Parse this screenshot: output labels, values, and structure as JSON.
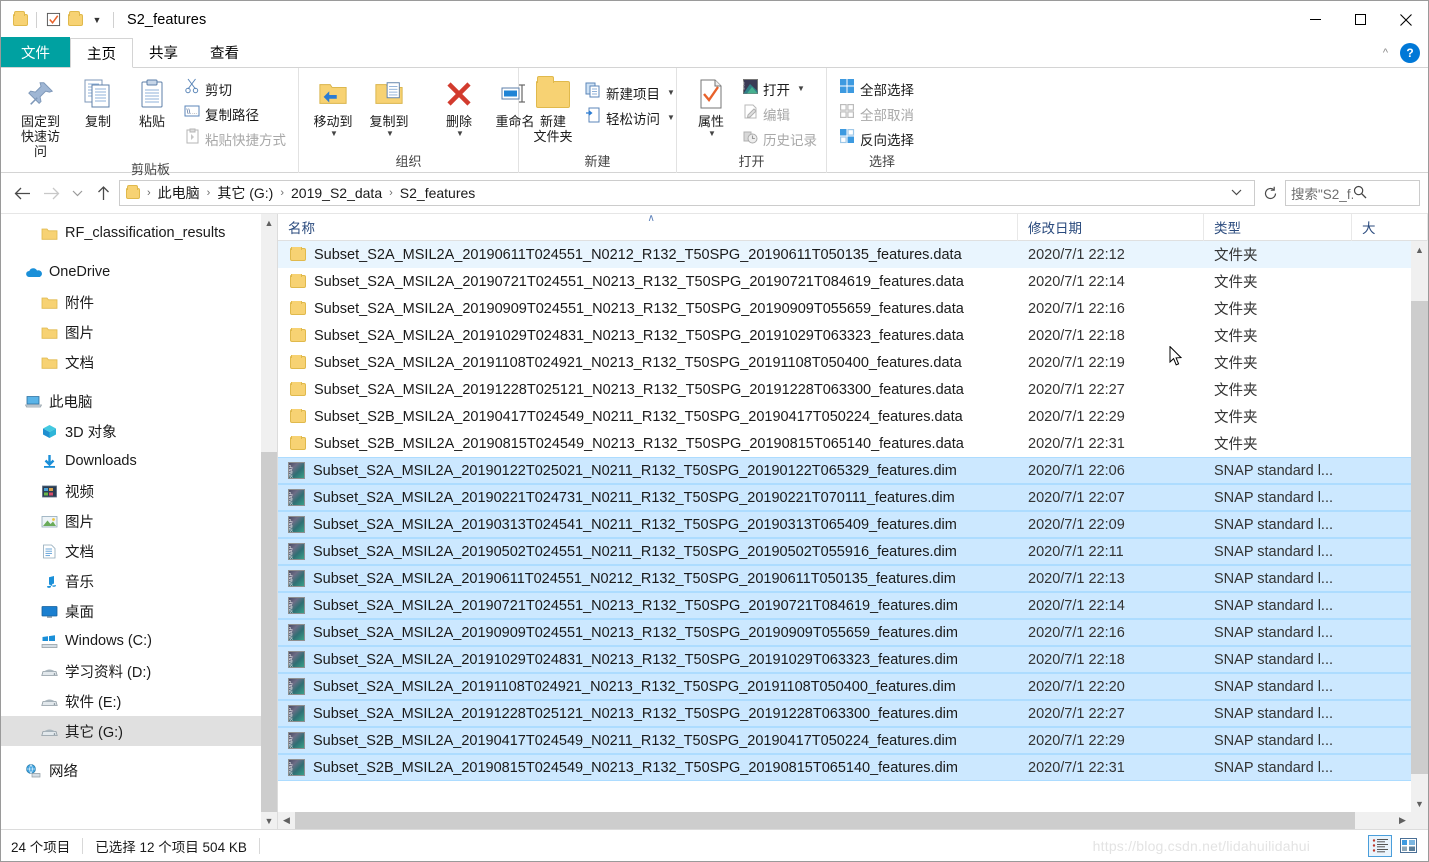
{
  "window": {
    "title": "S2_features",
    "minimize_label": "─",
    "maximize_label": "☐",
    "close_label": "✕",
    "qat_folder_icon": "folder-icon",
    "qat_properties_icon": "checkbox-properties-icon",
    "qat_newfolder_icon": "new-folder-icon",
    "qat_dropdown_icon": "chevron-down-icon"
  },
  "ribbon": {
    "tabs": [
      {
        "label": "文件",
        "id": "file"
      },
      {
        "label": "主页",
        "id": "home"
      },
      {
        "label": "共享",
        "id": "share"
      },
      {
        "label": "查看",
        "id": "view"
      }
    ],
    "collapse_icon": "chevron-up-icon",
    "help_label": "?",
    "groups": [
      {
        "name": "剪贴板",
        "big": [
          {
            "label1": "固定到",
            "label2": "快速访问",
            "icon": "pin-icon"
          },
          {
            "label1": "复制",
            "label2": "",
            "icon": "copy-icon"
          },
          {
            "label1": "粘贴",
            "label2": "",
            "icon": "paste-icon"
          }
        ],
        "small": [
          {
            "label": "剪切",
            "icon": "scissors-icon",
            "disabled": false
          },
          {
            "label": "复制路径",
            "icon": "copy-path-icon",
            "disabled": false
          },
          {
            "label": "粘贴快捷方式",
            "icon": "paste-shortcut-icon",
            "disabled": true
          }
        ]
      },
      {
        "name": "组织",
        "big": [
          {
            "label1": "移动到",
            "label2": "",
            "icon": "move-to-icon",
            "caret": true
          },
          {
            "label1": "复制到",
            "label2": "",
            "icon": "copy-to-icon",
            "caret": true
          },
          {
            "label1": "删除",
            "label2": "",
            "icon": "delete-icon",
            "caret": true
          },
          {
            "label1": "重命名",
            "label2": "",
            "icon": "rename-icon"
          }
        ],
        "small": []
      },
      {
        "name": "新建",
        "big": [
          {
            "label1": "新建",
            "label2": "文件夹",
            "icon": "new-folder-icon"
          }
        ],
        "small": [
          {
            "label": "新建项目",
            "icon": "new-item-icon",
            "disabled": false,
            "caret": true
          },
          {
            "label": "轻松访问",
            "icon": "easy-access-icon",
            "disabled": false,
            "caret": true
          }
        ]
      },
      {
        "name": "打开",
        "big": [
          {
            "label1": "属性",
            "label2": "",
            "icon": "properties-icon",
            "caret": true
          }
        ],
        "small": [
          {
            "label": "打开",
            "icon": "open-snap-icon",
            "disabled": false,
            "caret": true
          },
          {
            "label": "编辑",
            "icon": "edit-icon",
            "disabled": true
          },
          {
            "label": "历史记录",
            "icon": "history-icon",
            "disabled": true
          }
        ]
      },
      {
        "name": "选择",
        "big": [],
        "small": [
          {
            "label": "全部选择",
            "icon": "select-all-icon",
            "disabled": false
          },
          {
            "label": "全部取消",
            "icon": "select-none-icon",
            "disabled": true
          },
          {
            "label": "反向选择",
            "icon": "invert-selection-icon",
            "disabled": false
          }
        ]
      }
    ]
  },
  "addressbar": {
    "back_icon": "arrow-left-icon",
    "forward_icon": "arrow-right-icon",
    "recent_icon": "chevron-down-icon",
    "up_icon": "arrow-up-icon",
    "folder_icon": "folder-icon",
    "breadcrumbs": [
      "此电脑",
      "其它 (G:)",
      "2019_S2_data",
      "S2_features"
    ],
    "separator": "›",
    "dropdown_icon": "chevron-down-icon",
    "refresh_icon": "refresh-icon",
    "search_placeholder": "搜索\"S2_f...",
    "search_icon": "search-icon"
  },
  "navpane": {
    "items": [
      {
        "label": "RF_classification_results",
        "icon": "folder-icon",
        "indent": 2,
        "selected": false
      },
      {
        "gap": true
      },
      {
        "label": "OneDrive",
        "icon": "onedrive-icon",
        "indent": 1,
        "selected": false
      },
      {
        "label": "附件",
        "icon": "folder-icon",
        "indent": 2,
        "selected": false
      },
      {
        "label": "图片",
        "icon": "folder-icon",
        "indent": 2,
        "selected": false
      },
      {
        "label": "文档",
        "icon": "folder-icon",
        "indent": 2,
        "selected": false
      },
      {
        "gap": true
      },
      {
        "label": "此电脑",
        "icon": "this-pc-icon",
        "indent": 1,
        "selected": false
      },
      {
        "label": "3D 对象",
        "icon": "3d-objects-icon",
        "indent": 2,
        "selected": false
      },
      {
        "label": "Downloads",
        "icon": "downloads-icon",
        "indent": 2,
        "selected": false
      },
      {
        "label": "视频",
        "icon": "videos-icon",
        "indent": 2,
        "selected": false
      },
      {
        "label": "图片",
        "icon": "pictures-icon",
        "indent": 2,
        "selected": false
      },
      {
        "label": "文档",
        "icon": "documents-icon",
        "indent": 2,
        "selected": false
      },
      {
        "label": "音乐",
        "icon": "music-icon",
        "indent": 2,
        "selected": false
      },
      {
        "label": "桌面",
        "icon": "desktop-icon",
        "indent": 2,
        "selected": false
      },
      {
        "label": "Windows (C:)",
        "icon": "windows-drive-icon",
        "indent": 2,
        "selected": false
      },
      {
        "label": "学习资料 (D:)",
        "icon": "drive-icon",
        "indent": 2,
        "selected": false
      },
      {
        "label": "软件 (E:)",
        "icon": "drive-icon",
        "indent": 2,
        "selected": false
      },
      {
        "label": "其它 (G:)",
        "icon": "drive-icon",
        "indent": 2,
        "selected": true
      },
      {
        "gap": true
      },
      {
        "label": "网络",
        "icon": "network-icon",
        "indent": 1,
        "selected": false
      }
    ],
    "scroll_up_icon": "chevron-up-icon",
    "scroll_down_icon": "chevron-down-icon"
  },
  "filelist": {
    "columns": [
      {
        "label": "名称",
        "key": "name",
        "sorted": true
      },
      {
        "label": "修改日期",
        "key": "date"
      },
      {
        "label": "类型",
        "key": "type"
      },
      {
        "label": "大",
        "key": "size"
      }
    ],
    "sort_indicator": "∧",
    "rows": [
      {
        "name": "Subset_S2A_MSIL2A_20190611T024551_N0212_R132_T50SPG_20190611T050135_features.data",
        "date": "2020/7/1 22:12",
        "type": "文件夹",
        "size": "",
        "icon": "folder-icon",
        "state": "hover"
      },
      {
        "name": "Subset_S2A_MSIL2A_20190721T024551_N0213_R132_T50SPG_20190721T084619_features.data",
        "date": "2020/7/1 22:14",
        "type": "文件夹",
        "size": "",
        "icon": "folder-icon",
        "state": "none"
      },
      {
        "name": "Subset_S2A_MSIL2A_20190909T024551_N0213_R132_T50SPG_20190909T055659_features.data",
        "date": "2020/7/1 22:16",
        "type": "文件夹",
        "size": "",
        "icon": "folder-icon",
        "state": "none"
      },
      {
        "name": "Subset_S2A_MSIL2A_20191029T024831_N0213_R132_T50SPG_20191029T063323_features.data",
        "date": "2020/7/1 22:18",
        "type": "文件夹",
        "size": "",
        "icon": "folder-icon",
        "state": "none"
      },
      {
        "name": "Subset_S2A_MSIL2A_20191108T024921_N0213_R132_T50SPG_20191108T050400_features.data",
        "date": "2020/7/1 22:19",
        "type": "文件夹",
        "size": "",
        "icon": "folder-icon",
        "state": "none"
      },
      {
        "name": "Subset_S2A_MSIL2A_20191228T025121_N0213_R132_T50SPG_20191228T063300_features.data",
        "date": "2020/7/1 22:27",
        "type": "文件夹",
        "size": "",
        "icon": "folder-icon",
        "state": "none"
      },
      {
        "name": "Subset_S2B_MSIL2A_20190417T024549_N0211_R132_T50SPG_20190417T050224_features.data",
        "date": "2020/7/1 22:29",
        "type": "文件夹",
        "size": "",
        "icon": "folder-icon",
        "state": "none"
      },
      {
        "name": "Subset_S2B_MSIL2A_20190815T024549_N0213_R132_T50SPG_20190815T065140_features.data",
        "date": "2020/7/1 22:31",
        "type": "文件夹",
        "size": "",
        "icon": "folder-icon",
        "state": "none"
      },
      {
        "name": "Subset_S2A_MSIL2A_20190122T025021_N0211_R132_T50SPG_20190122T065329_features.dim",
        "date": "2020/7/1 22:06",
        "type": "SNAP standard l...",
        "size": "",
        "icon": "snap-dim-icon",
        "state": "selected"
      },
      {
        "name": "Subset_S2A_MSIL2A_20190221T024731_N0211_R132_T50SPG_20190221T070111_features.dim",
        "date": "2020/7/1 22:07",
        "type": "SNAP standard l...",
        "size": "",
        "icon": "snap-dim-icon",
        "state": "selected"
      },
      {
        "name": "Subset_S2A_MSIL2A_20190313T024541_N0211_R132_T50SPG_20190313T065409_features.dim",
        "date": "2020/7/1 22:09",
        "type": "SNAP standard l...",
        "size": "",
        "icon": "snap-dim-icon",
        "state": "selected"
      },
      {
        "name": "Subset_S2A_MSIL2A_20190502T024551_N0211_R132_T50SPG_20190502T055916_features.dim",
        "date": "2020/7/1 22:11",
        "type": "SNAP standard l...",
        "size": "",
        "icon": "snap-dim-icon",
        "state": "selected"
      },
      {
        "name": "Subset_S2A_MSIL2A_20190611T024551_N0212_R132_T50SPG_20190611T050135_features.dim",
        "date": "2020/7/1 22:13",
        "type": "SNAP standard l...",
        "size": "",
        "icon": "snap-dim-icon",
        "state": "selected"
      },
      {
        "name": "Subset_S2A_MSIL2A_20190721T024551_N0213_R132_T50SPG_20190721T084619_features.dim",
        "date": "2020/7/1 22:14",
        "type": "SNAP standard l...",
        "size": "",
        "icon": "snap-dim-icon",
        "state": "selected"
      },
      {
        "name": "Subset_S2A_MSIL2A_20190909T024551_N0213_R132_T50SPG_20190909T055659_features.dim",
        "date": "2020/7/1 22:16",
        "type": "SNAP standard l...",
        "size": "",
        "icon": "snap-dim-icon",
        "state": "selected"
      },
      {
        "name": "Subset_S2A_MSIL2A_20191029T024831_N0213_R132_T50SPG_20191029T063323_features.dim",
        "date": "2020/7/1 22:18",
        "type": "SNAP standard l...",
        "size": "",
        "icon": "snap-dim-icon",
        "state": "selected"
      },
      {
        "name": "Subset_S2A_MSIL2A_20191108T024921_N0213_R132_T50SPG_20191108T050400_features.dim",
        "date": "2020/7/1 22:20",
        "type": "SNAP standard l...",
        "size": "",
        "icon": "snap-dim-icon",
        "state": "selected"
      },
      {
        "name": "Subset_S2A_MSIL2A_20191228T025121_N0213_R132_T50SPG_20191228T063300_features.dim",
        "date": "2020/7/1 22:27",
        "type": "SNAP standard l...",
        "size": "",
        "icon": "snap-dim-icon",
        "state": "selected"
      },
      {
        "name": "Subset_S2B_MSIL2A_20190417T024549_N0211_R132_T50SPG_20190417T050224_features.dim",
        "date": "2020/7/1 22:29",
        "type": "SNAP standard l...",
        "size": "",
        "icon": "snap-dim-icon",
        "state": "selected"
      },
      {
        "name": "Subset_S2B_MSIL2A_20190815T024549_N0213_R132_T50SPG_20190815T065140_features.dim",
        "date": "2020/7/1 22:31",
        "type": "SNAP standard l...",
        "size": "",
        "icon": "snap-dim-icon",
        "state": "selected"
      }
    ]
  },
  "statusbar": {
    "item_count": "24 个项目",
    "selection": "已选择 12 个项目  504 KB",
    "watermark": "https://blog.csdn.net/lidahuilidahui",
    "details_view_icon": "details-view-icon",
    "large_icons_view_icon": "large-icons-view-icon"
  },
  "colors": {
    "file_tab": "#00a1a1",
    "selection": "#cce8ff",
    "hover": "#e9f5fe",
    "column_header_text": "#2b4b7e",
    "accent": "#0078d7"
  }
}
